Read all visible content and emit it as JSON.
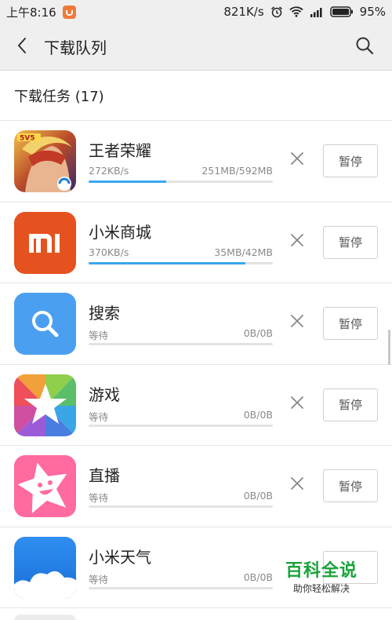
{
  "status": {
    "time": "上午8:16",
    "speed": "821K/s",
    "battery": "95%",
    "icons": [
      "alarm-icon",
      "wifi-icon",
      "signal-icon",
      "battery-icon"
    ]
  },
  "header": {
    "title": "下载队列",
    "back_icon": "chevron-left-icon",
    "search_icon": "search-icon"
  },
  "section": {
    "title": "下载任务 (17)"
  },
  "accent_color": "#38a8ee",
  "items": [
    {
      "name": "王者荣耀",
      "speed": "272KB/s",
      "size": "251MB/592MB",
      "progress": 0.42,
      "pause_label": "暂停",
      "icon": "honor-of-kings-icon"
    },
    {
      "name": "小米商城",
      "speed": "370KB/s",
      "size": "35MB/42MB",
      "progress": 0.85,
      "pause_label": "暂停",
      "icon": "mi-store-icon"
    },
    {
      "name": "搜索",
      "speed": "等待",
      "size": "0B/0B",
      "progress": 0,
      "pause_label": "暂停",
      "icon": "search-app-icon"
    },
    {
      "name": "游戏",
      "speed": "等待",
      "size": "0B/0B",
      "progress": 0,
      "pause_label": "暂停",
      "icon": "game-star-icon"
    },
    {
      "name": "直播",
      "speed": "等待",
      "size": "0B/0B",
      "progress": 0,
      "pause_label": "暂停",
      "icon": "live-star-icon"
    },
    {
      "name": "小米天气",
      "speed": "等待",
      "size": "0B/0B",
      "progress": 0,
      "pause_label": "暂停",
      "icon": "weather-cloud-icon"
    }
  ],
  "watermark": {
    "title": "百科全说",
    "subtitle": "助你轻松解决"
  }
}
